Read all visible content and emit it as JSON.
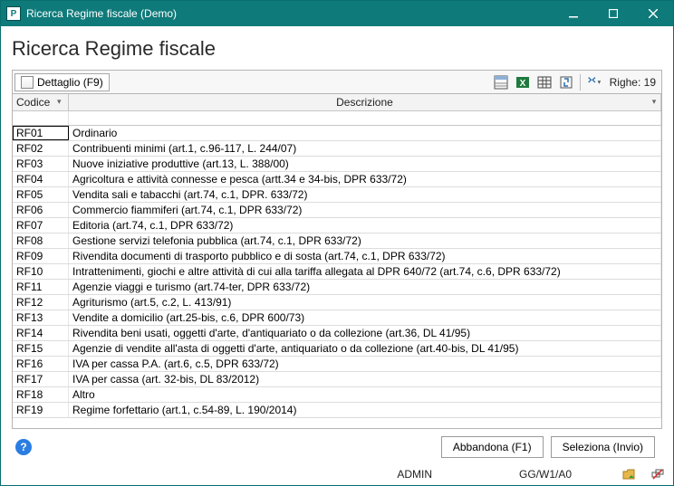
{
  "window": {
    "title": "Ricerca Regime fiscale  (Demo)"
  },
  "page": {
    "title": "Ricerca Regime fiscale"
  },
  "toolbar": {
    "detail_label": "Dettaglio (F9)",
    "rows_label": "Righe:",
    "rows_count": "19"
  },
  "table": {
    "columns": {
      "codice": "Codice",
      "descrizione": "Descrizione"
    },
    "rows": [
      {
        "codice": "RF01",
        "descrizione": "Ordinario"
      },
      {
        "codice": "RF02",
        "descrizione": "Contribuenti minimi (art.1, c.96-117, L. 244/07)"
      },
      {
        "codice": "RF03",
        "descrizione": "Nuove iniziative produttive (art.13, L. 388/00)"
      },
      {
        "codice": "RF04",
        "descrizione": "Agricoltura e attività connesse e pesca (artt.34 e 34-bis, DPR 633/72)"
      },
      {
        "codice": "RF05",
        "descrizione": "Vendita sali e tabacchi (art.74, c.1, DPR. 633/72)"
      },
      {
        "codice": "RF06",
        "descrizione": "Commercio fiammiferi (art.74, c.1, DPR  633/72)"
      },
      {
        "codice": "RF07",
        "descrizione": "Editoria (art.74, c.1, DPR  633/72)"
      },
      {
        "codice": "RF08",
        "descrizione": "Gestione servizi telefonia pubblica (art.74, c.1, DPR 633/72)"
      },
      {
        "codice": "RF09",
        "descrizione": "Rivendita documenti di trasporto pubblico e di sosta (art.74, c.1, DPR  633/72)"
      },
      {
        "codice": "RF10",
        "descrizione": "Intrattenimenti, giochi e altre attività di cui alla tariffa allegata al DPR 640/72 (art.74, c.6, DPR 633/72)"
      },
      {
        "codice": "RF11",
        "descrizione": "Agenzie viaggi e turismo (art.74-ter, DPR 633/72)"
      },
      {
        "codice": "RF12",
        "descrizione": "Agriturismo (art.5, c.2, L. 413/91)"
      },
      {
        "codice": "RF13",
        "descrizione": "Vendite a domicilio (art.25-bis, c.6, DPR  600/73)"
      },
      {
        "codice": "RF14",
        "descrizione": "Rivendita beni usati, oggetti d'arte, d'antiquariato o da collezione (art.36, DL 41/95)"
      },
      {
        "codice": "RF15",
        "descrizione": "Agenzie di vendite all'asta di oggetti d'arte, antiquariato o da collezione (art.40-bis, DL 41/95)"
      },
      {
        "codice": "RF16",
        "descrizione": "IVA per cassa P.A. (art.6, c.5, DPR 633/72)"
      },
      {
        "codice": "RF17",
        "descrizione": "IVA per cassa (art. 32-bis, DL 83/2012)"
      },
      {
        "codice": "RF18",
        "descrizione": "Altro"
      },
      {
        "codice": "RF19",
        "descrizione": "Regime forfettario (art.1, c.54-89, L. 190/2014)"
      }
    ],
    "selected_index": 0
  },
  "footer": {
    "abandon_label": "Abbandona (F1)",
    "select_label": "Seleziona (Invio)"
  },
  "statusbar": {
    "user": "ADMIN",
    "context": "GG/W1/A0"
  }
}
